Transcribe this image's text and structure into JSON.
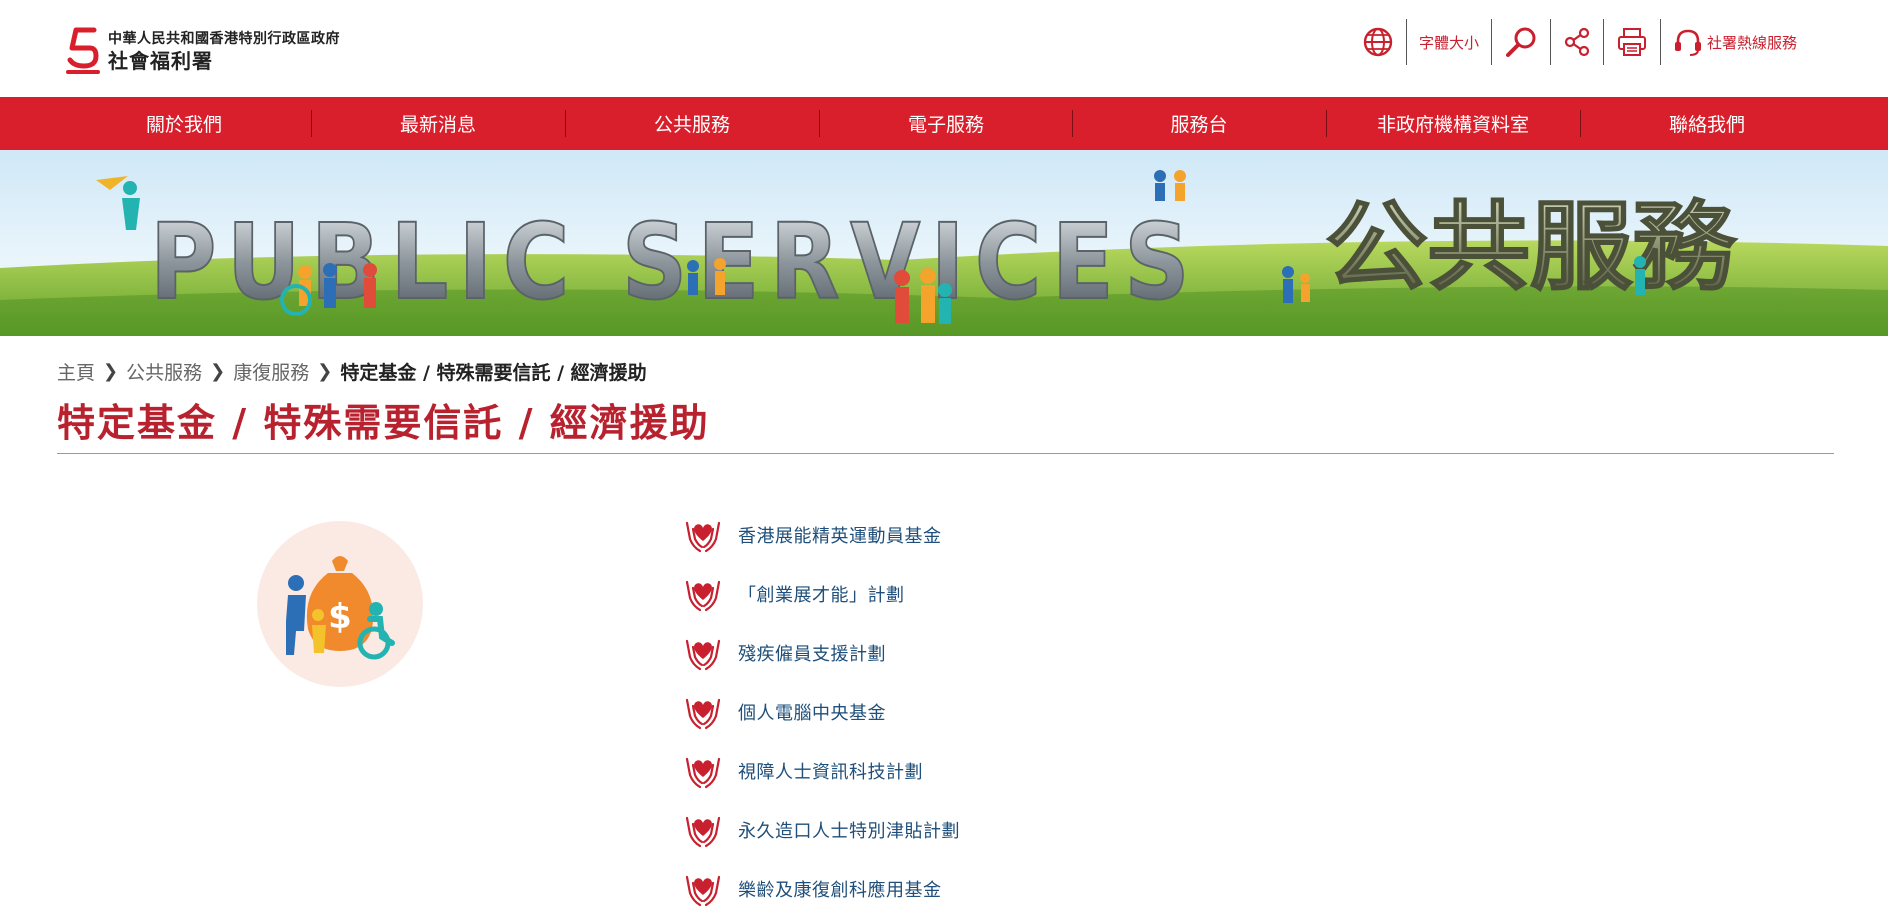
{
  "header": {
    "org_line1": "中華人民共和國香港特別行政區政府",
    "org_line2": "社會福利署",
    "font_size_label": "字體大小",
    "hotline_label": "社署熱線服務"
  },
  "nav": {
    "items": [
      {
        "label": "關於我們"
      },
      {
        "label": "最新消息"
      },
      {
        "label": "公共服務"
      },
      {
        "label": "電子服務"
      },
      {
        "label": "服務台"
      },
      {
        "label": "非政府機構資料室"
      },
      {
        "label": "聯絡我們"
      }
    ]
  },
  "banner": {
    "text_en": "PUBLIC SERVICES",
    "text_zh": "公共服務"
  },
  "breadcrumb": {
    "items": [
      "主頁",
      "公共服務",
      "康復服務"
    ],
    "current": "特定基金 / 特殊需要信託 / 經濟援助"
  },
  "page": {
    "title": "特定基金 / 特殊需要信託 / 經濟援助"
  },
  "links": [
    {
      "label": "香港展能精英運動員基金"
    },
    {
      "label": "「創業展才能」計劃"
    },
    {
      "label": "殘疾僱員支援計劃"
    },
    {
      "label": "個人電腦中央基金"
    },
    {
      "label": "視障人士資訊科技計劃"
    },
    {
      "label": "永久造口人士特別津貼計劃"
    },
    {
      "label": "樂齡及康復創科應用基金"
    }
  ],
  "colors": {
    "brand_red": "#d91f2b",
    "title_red": "#b8222f",
    "link_blue": "#1f4f7a"
  }
}
